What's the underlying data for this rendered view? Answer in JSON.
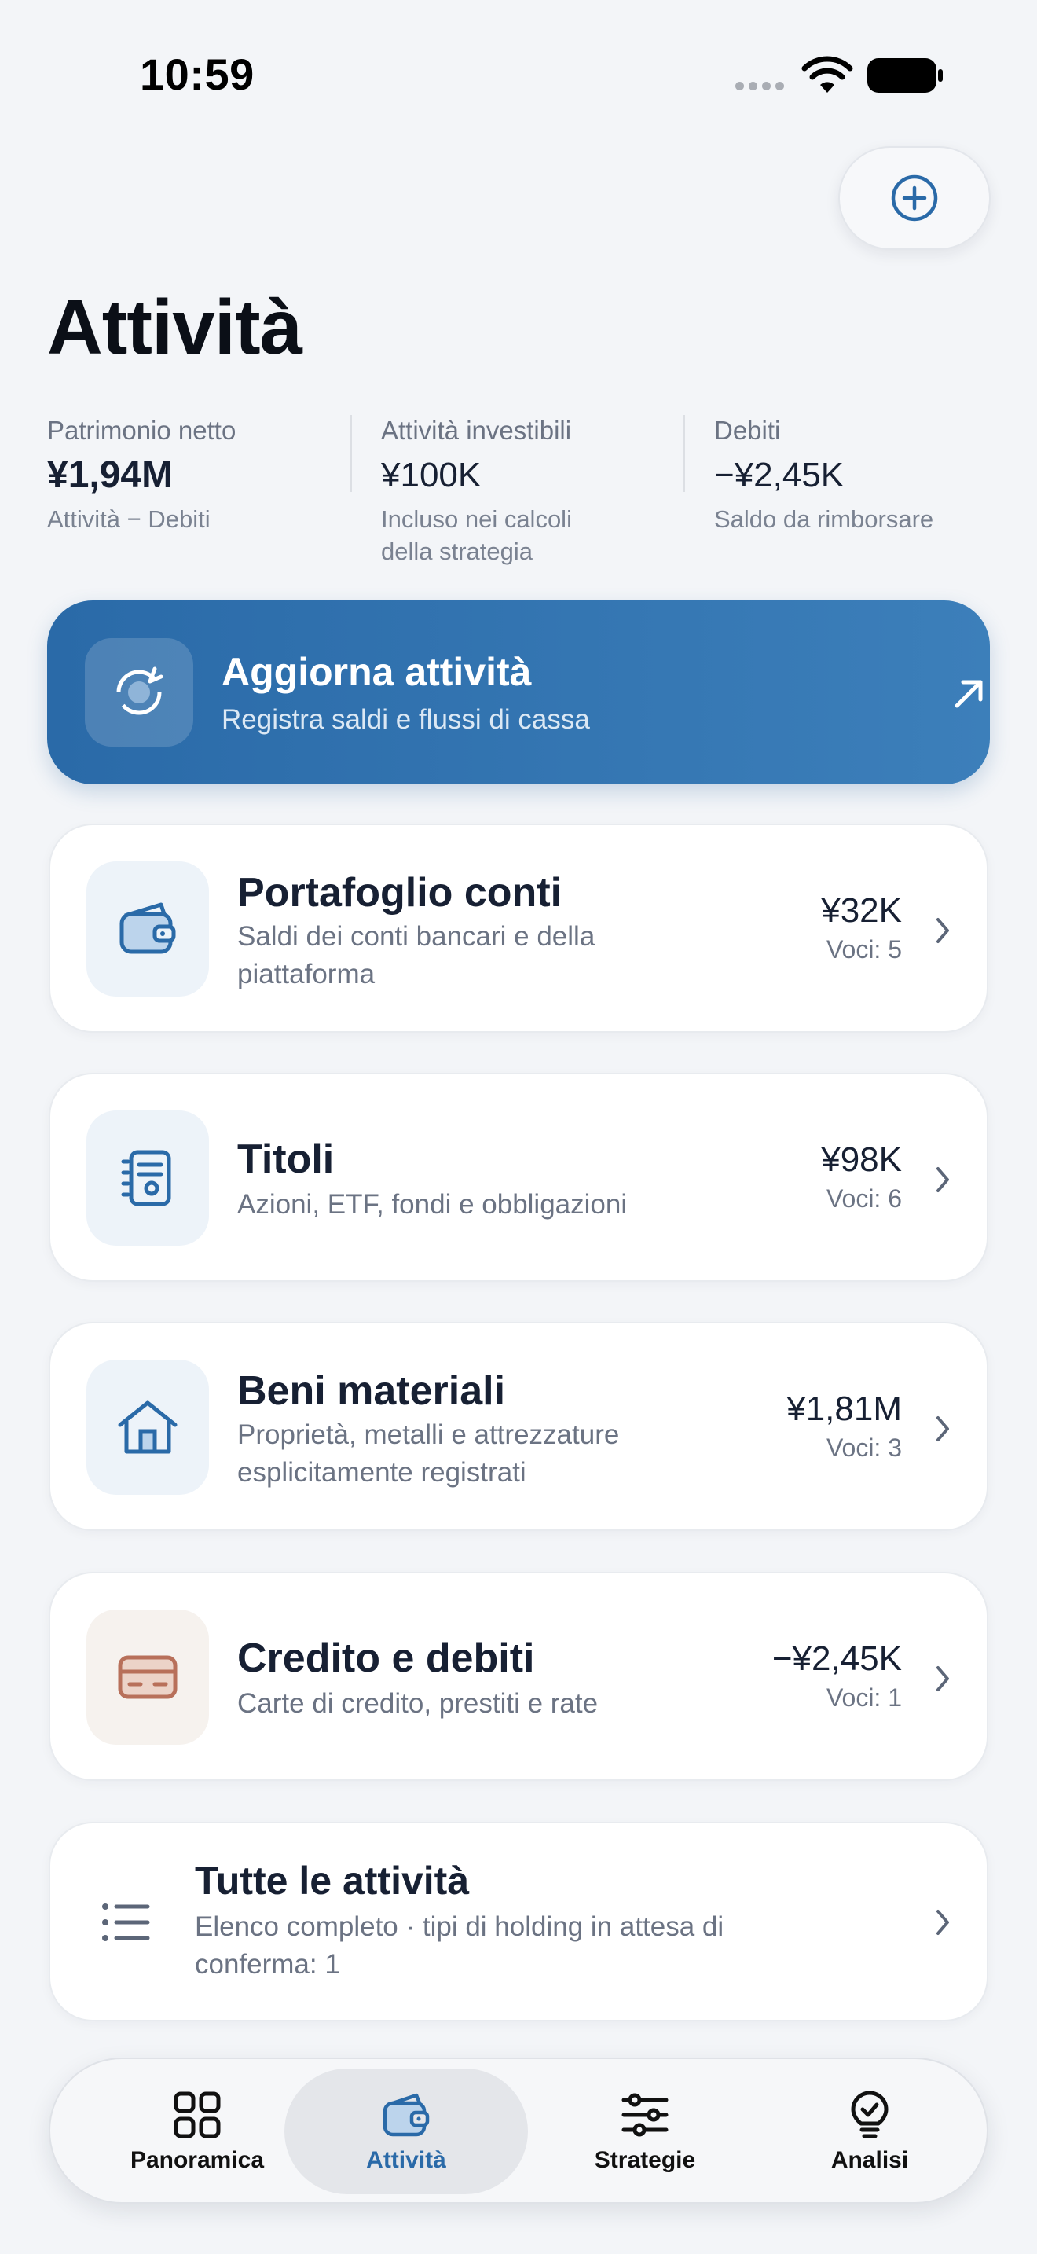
{
  "status_bar": {
    "time": "10:59"
  },
  "header": {
    "title": "Attività"
  },
  "summary": {
    "net_worth": {
      "label": "Patrimonio netto",
      "value": "¥1,94M",
      "note": "Attività − Debiti"
    },
    "investable": {
      "label": "Attività investibili",
      "value": "¥100K",
      "note_line1": "Incluso nei calcoli",
      "note_line2": "della strategia"
    },
    "debts": {
      "label": "Debiti",
      "value": "−¥2,45K",
      "note": "Saldo da rimborsare"
    }
  },
  "hero": {
    "title": "Aggiorna attività",
    "subtitle": "Registra saldi e flussi di cassa",
    "icon": "refresh-icon"
  },
  "categories": [
    {
      "title": "Portafoglio conti",
      "subtitle": "Saldi dei conti bancari e della piattaforma",
      "amount": "¥32K",
      "count": "Voci: 5",
      "icon": "wallet-icon"
    },
    {
      "title": "Titoli",
      "subtitle": "Azioni, ETF, fondi e obbligazioni",
      "amount": "¥98K",
      "count": "Voci: 6",
      "icon": "document-icon"
    },
    {
      "title": "Beni materiali",
      "subtitle": "Proprietà, metalli e attrezzature esplicitamente registrati",
      "amount": "¥1,81M",
      "count": "Voci: 3",
      "icon": "house-icon"
    },
    {
      "title": "Credito e debiti",
      "subtitle": "Carte di credito, prestiti e rate",
      "amount": "−¥2,45K",
      "count": "Voci: 1",
      "icon": "credit-card-icon"
    }
  ],
  "all_activities": {
    "title": "Tutte le attività",
    "subtitle": "Elenco completo · tipi di holding in attesa di conferma: 1",
    "icon": "list-icon"
  },
  "tabs": [
    {
      "label": "Panoramica",
      "icon": "grid-icon",
      "active": false
    },
    {
      "label": "Attività",
      "icon": "wallet-icon",
      "active": true
    },
    {
      "label": "Strategie",
      "icon": "sliders-icon",
      "active": false
    },
    {
      "label": "Analisi",
      "icon": "lightbulb-icon",
      "active": false
    }
  ],
  "colors": {
    "accent": "#2a6aa8",
    "background": "#f3f5f8",
    "debt_icon": "#b8705a"
  }
}
